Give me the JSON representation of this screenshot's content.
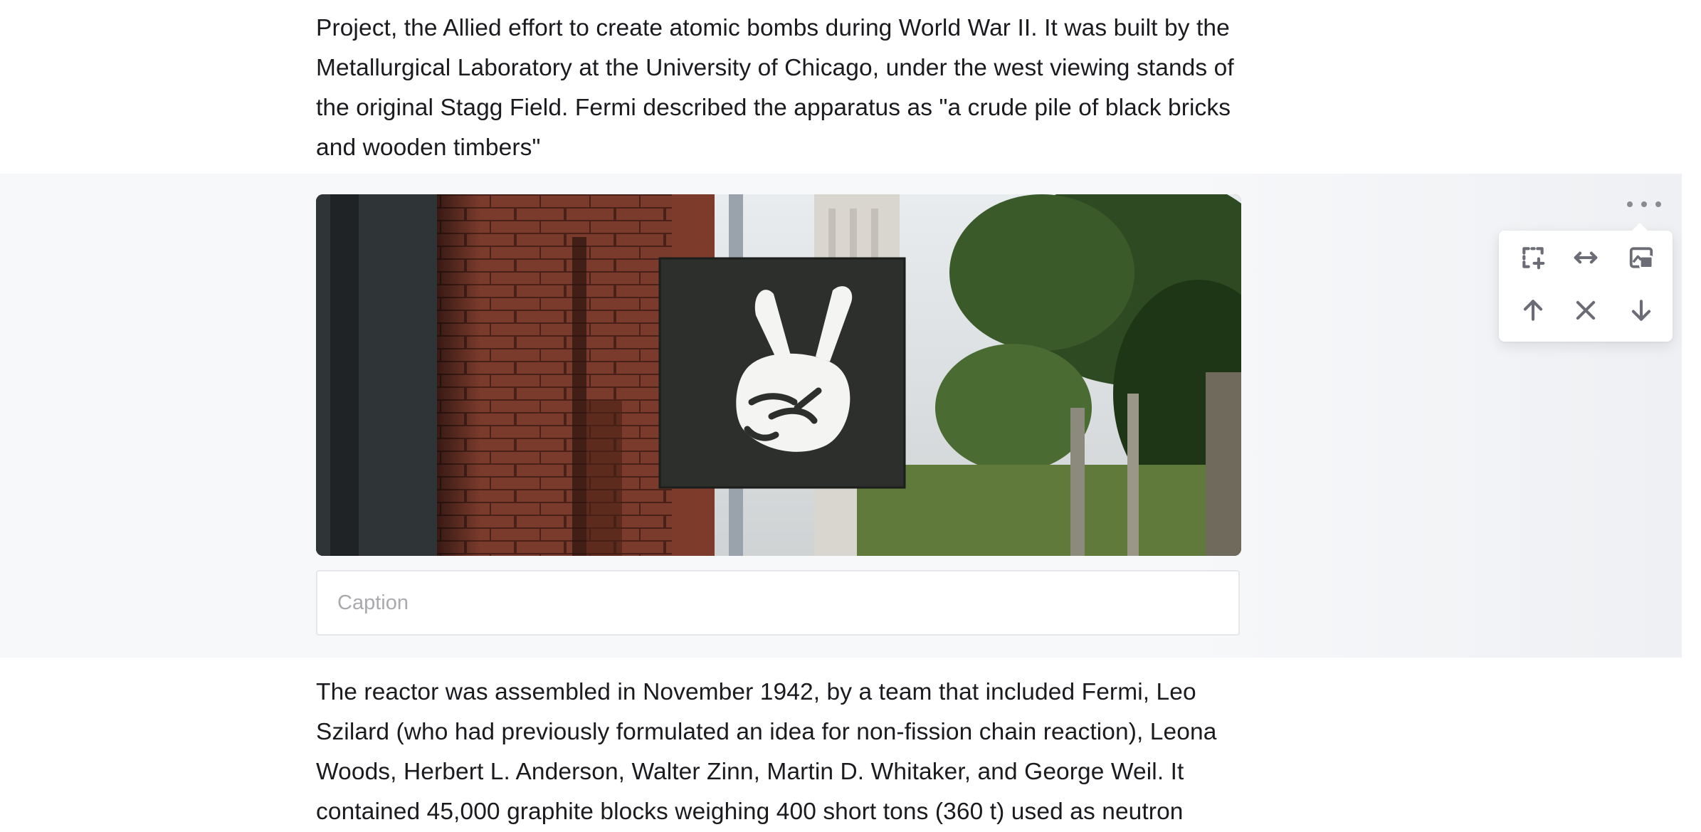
{
  "article": {
    "paragraph_top": [
      "Project, the Allied effort to create atomic bombs during World War II. It was built by the",
      "Metallurgical Laboratory at the University of Chicago, under the west viewing stands of",
      "the original Stagg Field. Fermi described the apparatus as \"a crude pile of black bricks",
      "and wooden timbers\""
    ],
    "paragraph_bottom": [
      "The reactor was assembled in November 1942, by a team that included Fermi, Leo",
      "Szilard (who had previously formulated an idea for non-fission chain reaction), Leona",
      "Woods, Herbert L. Anderson, Walter Zinn, Martin D. Whitaker, and George Weil. It",
      "contained 45,000 graphite blocks weighing 400 short tons (360 t) used as neutron"
    ]
  },
  "image_block": {
    "caption": {
      "value": "",
      "placeholder": "Caption"
    },
    "more_menu_icon": "more-horizontal-icon",
    "toolbar": {
      "row1": [
        {
          "icon": "add-to-selection-icon"
        },
        {
          "icon": "full-width-icon"
        },
        {
          "icon": "replace-image-icon"
        }
      ],
      "row2": [
        {
          "icon": "arrow-up-icon"
        },
        {
          "icon": "close-icon"
        },
        {
          "icon": "arrow-down-icon"
        }
      ]
    }
  },
  "colors": {
    "text": "#1b1b1f",
    "block_background": "#f7f8fa",
    "icon": "#6b6c75",
    "placeholder": "#a9aaad"
  }
}
